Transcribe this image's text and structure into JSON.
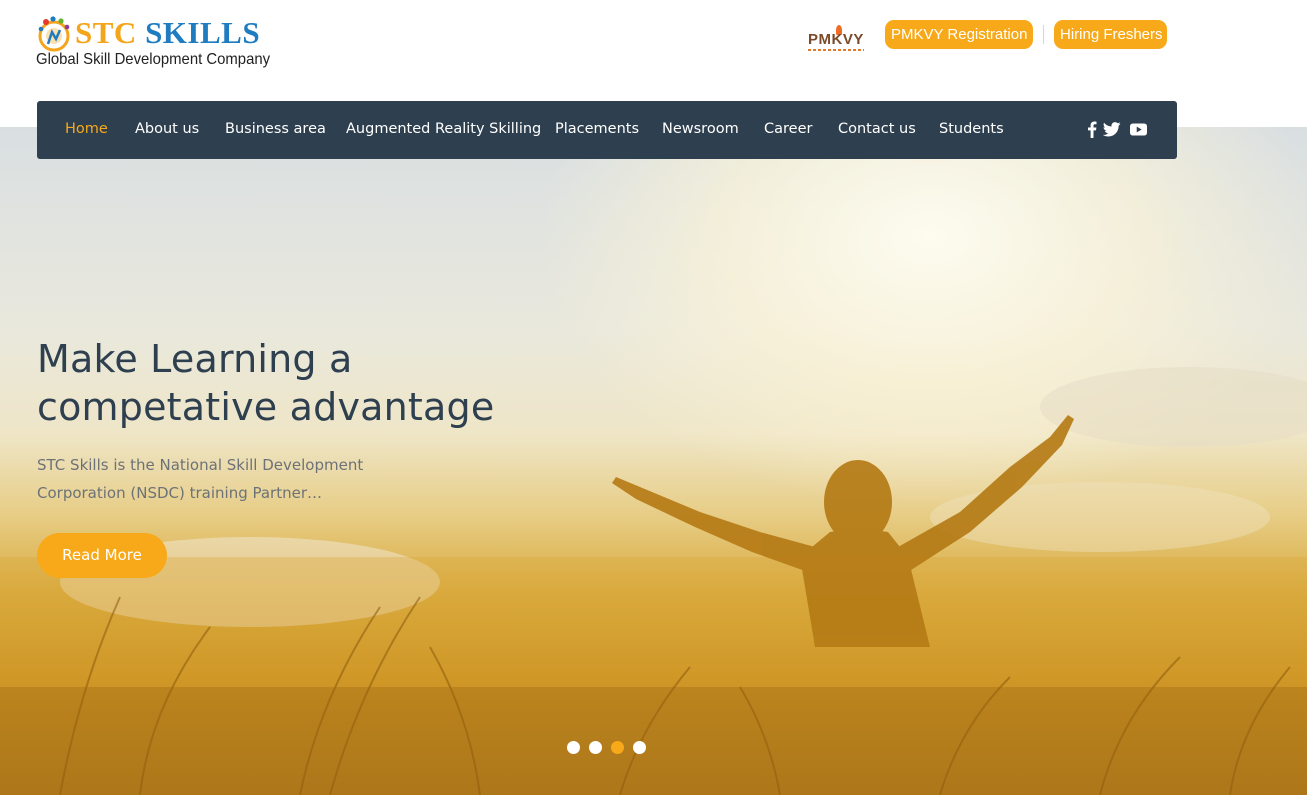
{
  "brand": {
    "name_part1": "STC",
    "name_part2": "SKILLS",
    "tagline": "Global Skill Development Company"
  },
  "header": {
    "partner_logo": "PMKVY",
    "buttons": [
      {
        "label": "PMKVY Registration"
      },
      {
        "label": "Hiring Freshers"
      }
    ]
  },
  "nav": {
    "items": [
      {
        "label": "Home",
        "active": true
      },
      {
        "label": "About us"
      },
      {
        "label": "Business area"
      },
      {
        "label": "Augmented Reality Skilling"
      },
      {
        "label": "Placements"
      },
      {
        "label": "Newsroom"
      },
      {
        "label": "Career"
      },
      {
        "label": "Contact us"
      },
      {
        "label": "Students"
      }
    ],
    "social_icons": [
      "facebook-icon",
      "twitter-icon",
      "youtube-icon"
    ]
  },
  "hero": {
    "title_line1": "Make Learning a",
    "title_line2": "competative advantage",
    "text_line1": "STC Skills is the National Skill Development",
    "text_line2": "Corporation (NSDC) training Partner…",
    "cta": "Read More",
    "slides": 4,
    "active_slide": 3
  },
  "colors": {
    "accent": "#f8a919",
    "nav_bg": "#2e3f4f",
    "brand_blue": "#1f7cc1",
    "brand_orange": "#f4a51c"
  }
}
